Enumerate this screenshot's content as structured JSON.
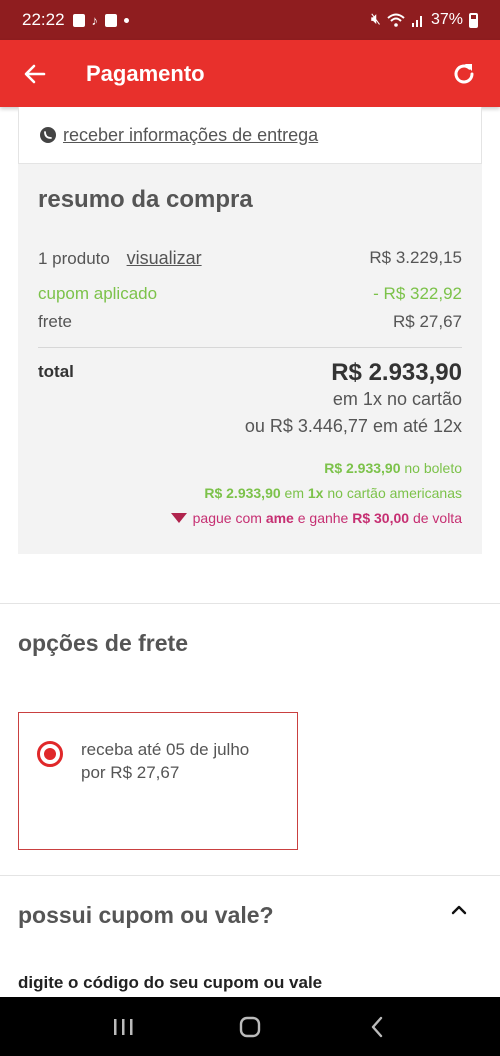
{
  "status": {
    "time": "22:22",
    "battery": "37%"
  },
  "app_bar": {
    "title": "Pagamento",
    "back_icon": "arrow-left-icon",
    "refresh_icon": "refresh-icon"
  },
  "delivery": {
    "link": "receber informações de entrega",
    "icon": "whatsapp-icon"
  },
  "summary": {
    "title": "resumo da compra",
    "product_label": "1 produto",
    "view_link": "visualizar",
    "product_value": "R$ 3.229,15",
    "coupon_label": "cupom aplicado",
    "coupon_value": "- R$ 322,92",
    "shipping_label": "frete",
    "shipping_value": "R$ 27,67",
    "total_label": "total",
    "total_value": "R$ 2.933,90",
    "total_sub1": "em 1x no cartão",
    "total_sub2": "ou R$ 3.446,77 em até 12x",
    "boleto_value": "R$ 2.933,90",
    "boleto_text": "no boleto",
    "card_value": "R$ 2.933,90",
    "card_em": "em",
    "card_1x": "1x",
    "card_text": "no cartão americanas",
    "ame_prefix": "pague com",
    "ame_brand": "ame",
    "ame_mid": "e ganhe",
    "ame_value": "R$ 30,00",
    "ame_suffix": "de volta",
    "colors": {
      "green": "#7cc24a",
      "pink": "#c62f72",
      "red": "#e8302c"
    }
  },
  "freight": {
    "title": "opções de frete",
    "option_line1": "receba até 05 de julho",
    "option_line2": "por R$ 27,67"
  },
  "coupon": {
    "title": "possui cupom ou vale?",
    "input_label": "digite o código do seu cupom ou vale"
  },
  "nav": {
    "recents_icon": "recents-icon",
    "home_icon": "home-icon",
    "back_icon": "back-chevron-icon"
  }
}
